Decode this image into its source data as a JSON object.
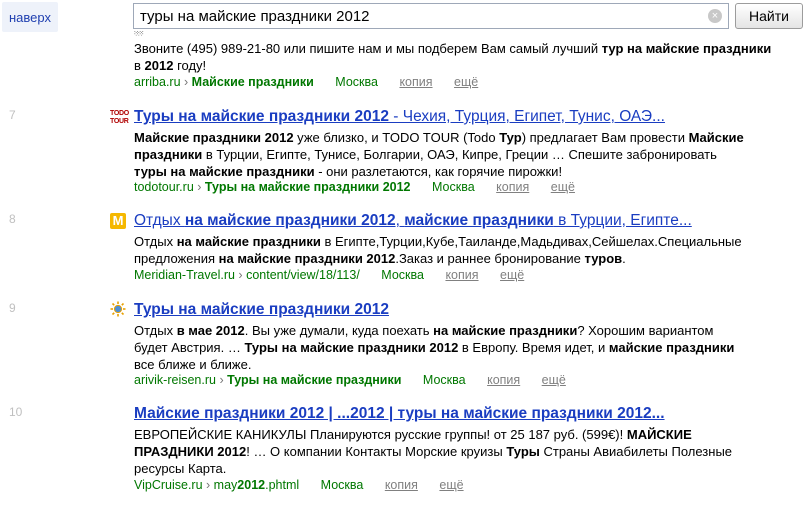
{
  "top_link": "наверх",
  "search": {
    "value": "туры на майские праздники 2012",
    "button": "Найти"
  },
  "partial_result": {
    "snippet_pre": "Звоните (495) 989-21-80 или пишите нам и мы подберем Вам самый лучший ",
    "snippet_b1": "тур на майские праздники",
    "snippet_mid": " в ",
    "snippet_b2": "2012",
    "snippet_post": " году!",
    "url_host": "arriba.ru",
    "url_sep": " › ",
    "url_path": "Майские праздники",
    "city": "Москва",
    "copy": "копия",
    "more": "ещё"
  },
  "results": [
    {
      "number": "7",
      "favicon": "TODO TOUR",
      "title_main": "Туры на майские праздники 2012",
      "title_tail": " - Чехия, Турция, Египет, Тунис, ОАЭ...",
      "line1_b1": "Майские праздники 2012",
      "line1_t1": " уже близко, и TODO TOUR (Todo ",
      "line1_b2": "Тур",
      "line1_t2": ") предлагает Вам провести ",
      "line1_b3": "Майские",
      "line2_b1": "праздники",
      "line2_t1": " в Турции, Египте, Тунисе, Болгарии, ОАЭ, Кипре, Греции … Спешите забронировать",
      "line3_b1": "туры на майские праздники",
      "line3_t1": " - они разлетаются, как горячие пирожки!",
      "url_host": "todotour.ru",
      "url_sep": " › ",
      "url_path": "Туры на майские праздники 2012",
      "city": "Москва",
      "copy": "копия",
      "more": "ещё"
    },
    {
      "number": "8",
      "favicon": "M",
      "title_t1": "Отдых ",
      "title_b1": "на майские праздники 2012",
      "title_t2": ", ",
      "title_b2": "майские праздники",
      "title_t3": " в Турции, Египте...",
      "line1_t1": "Отдых ",
      "line1_b1": "на майские праздники",
      "line1_t2": " в Египте,Турции,Кубе,Таиланде,Мадьдивах,Сейшелах.Специальные",
      "line2_t1": "предложения ",
      "line2_b1": "на майские праздники 2012",
      "line2_t2": ".Заказ и раннее бронирование ",
      "line2_b2": "туров",
      "line2_t3": ".",
      "url_host": "Meridian-Travel.ru",
      "url_sep": " › ",
      "url_path": "content/view/18/113/",
      "city": "Москва",
      "copy": "копия",
      "more": "ещё"
    },
    {
      "number": "9",
      "favicon": "sun-icon",
      "title_main": "Туры на майские праздники 2012",
      "line1_t1": "Отдых ",
      "line1_b1": "в мае 2012",
      "line1_t2": ". Вы уже думали, куда поехать ",
      "line1_b2": "на майские праздники",
      "line1_t3": "? Хорошим вариантом",
      "line2_t1": "будет Австрия. … ",
      "line2_b1": "Туры на майские праздники 2012",
      "line2_t2": " в Европу. Время идет, и ",
      "line2_b2": "майские праздники",
      "line3_t1": "все ближе и ближе.",
      "url_host": "arivik-reisen.ru",
      "url_sep": " › ",
      "url_path": "Туры на майские праздники",
      "city": "Москва",
      "copy": "копия",
      "more": "ещё"
    },
    {
      "number": "10",
      "title_main": "Майские праздники 2012 | ...2012 | туры на майские праздники 2012...",
      "line1_t1": "ЕВРОПЕЙСКИЕ КАНИКУЛЫ Планируются русские группы! от 25 187 руб. (599€)! ",
      "line1_b1": "МАЙСКИЕ",
      "line2_b1": "ПРАЗДНИКИ 2012",
      "line2_t1": "! … О компании Контакты Морские круизы ",
      "line2_b2": "Туры",
      "line2_t2": " Страны Авиабилеты Полезные",
      "line3_t1": "ресурсы Карта.",
      "url_host": "VipCruise.ru",
      "url_sep": " › ",
      "url_path_pre": "may",
      "url_path_b": "2012",
      "url_path_post": ".phtml",
      "city": "Москва",
      "copy": "копия",
      "more": "ещё"
    }
  ],
  "colors": {
    "link": "#1a3dc1",
    "url": "#007700",
    "muted": "#808080",
    "number": "#c0c0c0"
  }
}
